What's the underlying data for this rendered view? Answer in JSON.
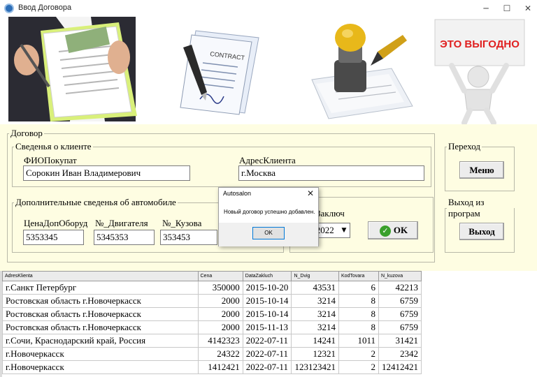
{
  "window": {
    "title": "Ввод Договора",
    "minimize_icon": "minimize-icon",
    "maximize_icon": "maximize-icon",
    "close_icon": "close-icon"
  },
  "banner": {
    "contract_caption": "CONTRACT",
    "promo_sign": "ЭТО ВЫГОДНО"
  },
  "form": {
    "group_title": "Договор",
    "client": {
      "title": "Сведенья о клиенте",
      "fio_label": "ФИОПокупат",
      "fio_value": "Сорокин Иван Владимерович",
      "address_label": "АдресКлиента",
      "address_value": "г.Москва"
    },
    "auto": {
      "title": "Дополнительные сведенья об автомобиле",
      "price_label": "ЦенаДопОборуд",
      "price_value": "5353345",
      "engine_label": "№_Двигателя",
      "engine_value": "5345353",
      "body_label": "№_Кузова",
      "body_value": "353453"
    },
    "zakl": {
      "label": "Заключ",
      "date_value": "7.2022",
      "ok_label": "OK"
    },
    "perehod": {
      "title": "Переход",
      "menu_label": "Меню"
    },
    "exit": {
      "title": "Выход из програм",
      "exit_label": "Выход"
    }
  },
  "dialog": {
    "title": "Autosalon",
    "message": "Новый договор успешно добавлен.",
    "ok_label": "OK"
  },
  "grid": {
    "columns": [
      "AdresKlienta",
      "Cena",
      "DataZakluch",
      "N_Dvig",
      "KodTovara",
      "N_kuzova"
    ],
    "rows": [
      [
        "г.Санкт Петербург",
        "350000",
        "2015-10-20",
        "43531",
        "6",
        "42213"
      ],
      [
        "Ростовская область г.Новочеркасск",
        "2000",
        "2015-10-14",
        "3214",
        "8",
        "6759"
      ],
      [
        "Ростовская область г.Новочеркасск",
        "2000",
        "2015-10-14",
        "3214",
        "8",
        "6759"
      ],
      [
        "Ростовская область г.Новочеркасск",
        "2000",
        "2015-11-13",
        "3214",
        "8",
        "6759"
      ],
      [
        "г.Сочи, Краснодарский край, Россия",
        "4142323",
        "2022-07-11",
        "14241",
        "1011",
        "31421"
      ],
      [
        "г.Новочеркасск",
        "24322",
        "2022-07-11",
        "12321",
        "2",
        "2342"
      ],
      [
        "г.Новочеркасск",
        "1412421",
        "2022-07-11",
        "123123421",
        "2",
        "12412421"
      ]
    ]
  }
}
